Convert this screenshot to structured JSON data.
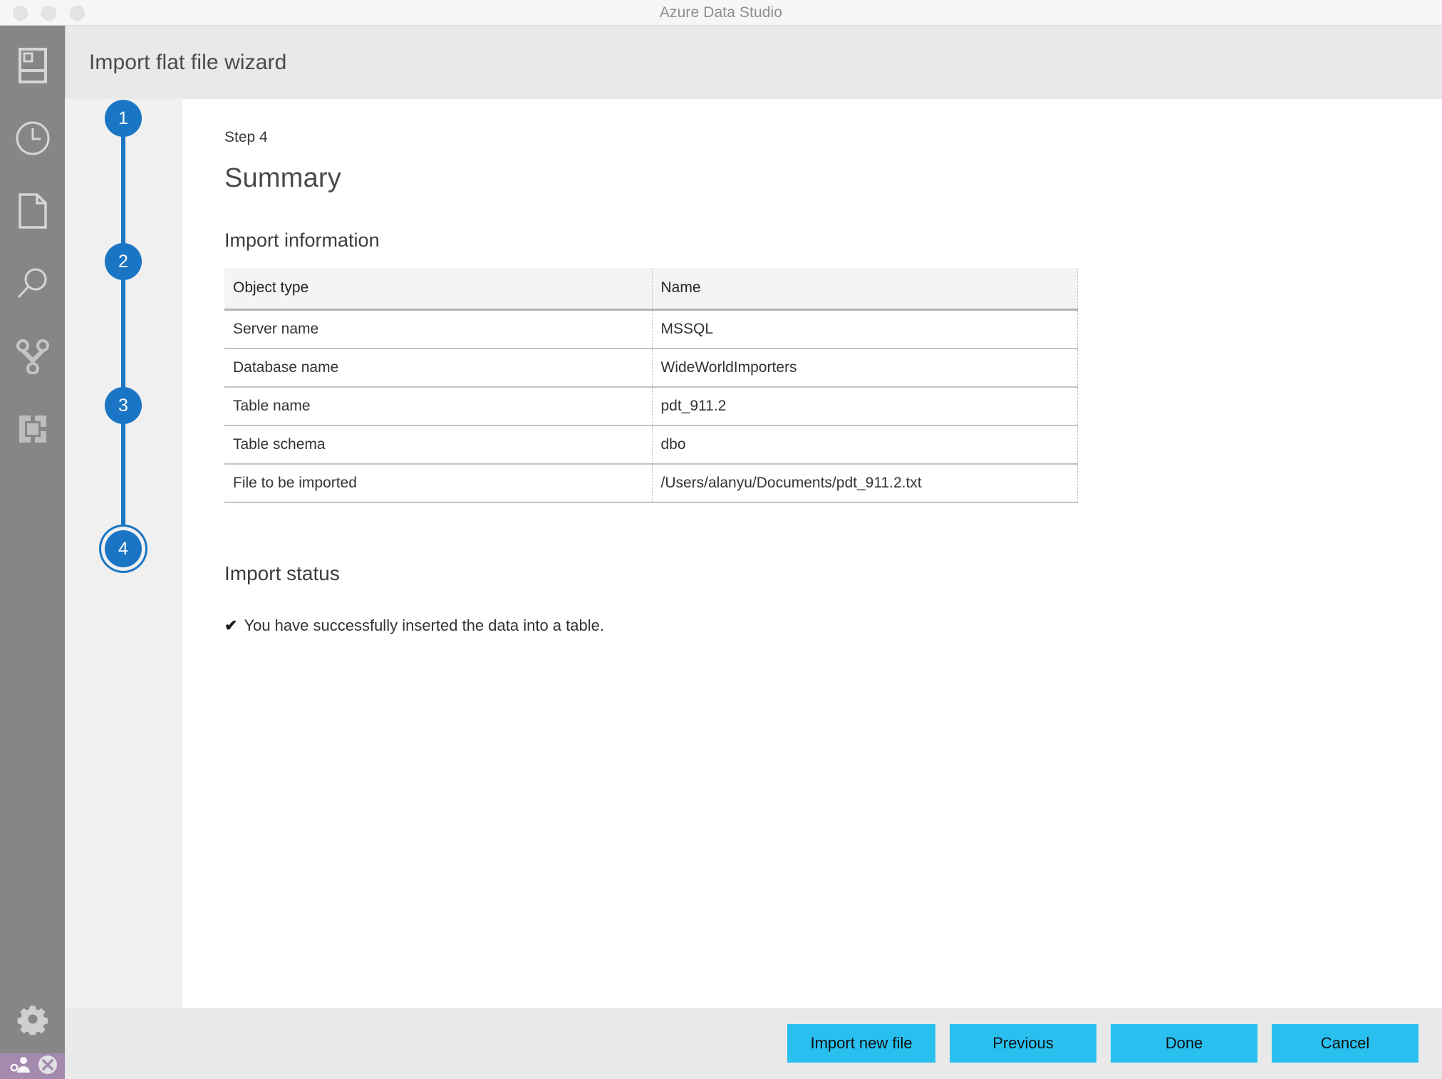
{
  "window": {
    "app_title": "Azure Data Studio",
    "traffic_lights": [
      "close-button",
      "minimize-button",
      "zoom-button"
    ]
  },
  "activitybar": {
    "items": [
      {
        "name": "servers-icon",
        "label": "Servers"
      },
      {
        "name": "history-icon",
        "label": "Query History"
      },
      {
        "name": "file-icon",
        "label": "Notebooks"
      },
      {
        "name": "search-icon",
        "label": "Search"
      },
      {
        "name": "source-control-icon",
        "label": "Source Control"
      },
      {
        "name": "extensions-icon",
        "label": "Extensions"
      }
    ],
    "bottom_items": [
      {
        "name": "gear-icon",
        "label": "Manage"
      }
    ],
    "statusbar_items": [
      {
        "name": "remote-accounts-icon",
        "label": "Accounts"
      },
      {
        "name": "error-close-icon",
        "label": "Errors"
      }
    ]
  },
  "wizard": {
    "title": "Import flat file wizard",
    "steps": [
      {
        "number": "1",
        "focused": false
      },
      {
        "number": "2",
        "focused": false
      },
      {
        "number": "3",
        "focused": false
      },
      {
        "number": "4",
        "focused": true
      }
    ],
    "step_label": "Step 4",
    "page_title": "Summary"
  },
  "import_information": {
    "section_title": "Import information",
    "columns": [
      "Object type",
      "Name"
    ],
    "rows": [
      {
        "type": "Server name",
        "name": "MSSQL"
      },
      {
        "type": "Database name",
        "name": "WideWorldImporters"
      },
      {
        "type": "Table name",
        "name": "pdt_911.2"
      },
      {
        "type": "Table schema",
        "name": "dbo"
      },
      {
        "type": "File to be imported",
        "name": "/Users/alanyu/Documents/pdt_911.2.txt"
      }
    ]
  },
  "import_status": {
    "section_title": "Import status",
    "check_glyph": "✔",
    "message": "You have successfully inserted the data into a table."
  },
  "footer": {
    "buttons": [
      {
        "label": "Import new file",
        "name": "import-new-file-button"
      },
      {
        "label": "Previous",
        "name": "previous-button"
      },
      {
        "label": "Done",
        "name": "done-button"
      },
      {
        "label": "Cancel",
        "name": "cancel-button"
      }
    ]
  },
  "colors": {
    "accent_blue": "#1a76c4",
    "button_cyan": "#29c0f0",
    "activitybar_grey": "#868686",
    "statusbar_purple": "#a48aae",
    "panel_grey": "#e9e9e9",
    "rail_grey": "#f0f0f0"
  }
}
